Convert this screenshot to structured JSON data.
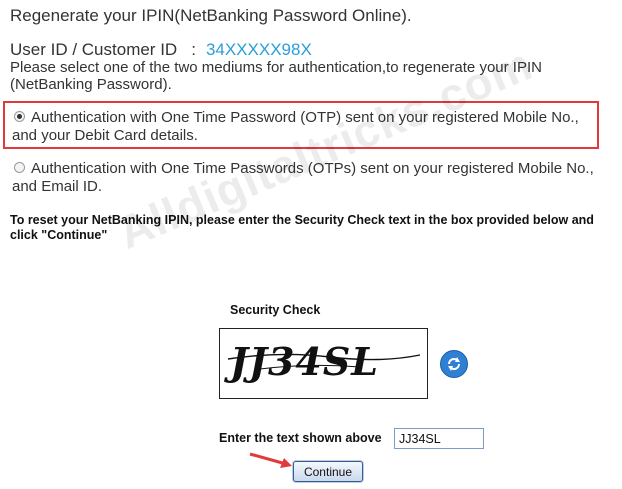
{
  "page": {
    "heading": "Regenerate your IPIN(NetBanking Password Online).",
    "user_id_label": "User ID / Customer ID",
    "user_id_separator": ":",
    "user_id_value": "34XXXXX98X",
    "instruction": "Please select one of the two mediums for authentication,to regenerate your IPIN (NetBanking Password).",
    "options": [
      {
        "label": "Authentication with One Time Password (OTP) sent on your registered Mobile No., and your Debit Card details.",
        "selected": true
      },
      {
        "label": "Authentication with One Time Passwords (OTPs) sent on your registered Mobile No., and Email ID.",
        "selected": false
      }
    ],
    "reset_instruction": "To reset your NetBanking IPIN, please enter the Security Check text in the box provided below and click \"Continue\"",
    "watermark": "Alldigitaltricks.com"
  },
  "security": {
    "label": "Security Check",
    "captcha_text": "JJ34SL",
    "refresh_icon": "refresh-icon",
    "enter_label": "Enter the text shown above",
    "input_value": "JJ34SL",
    "continue_label": "Continue"
  },
  "colors": {
    "highlight_border": "#e23a3a",
    "user_id_value": "#2a9fd8",
    "refresh_button": "#2f7fd3",
    "annotation_arrow": "#e23a3a"
  }
}
